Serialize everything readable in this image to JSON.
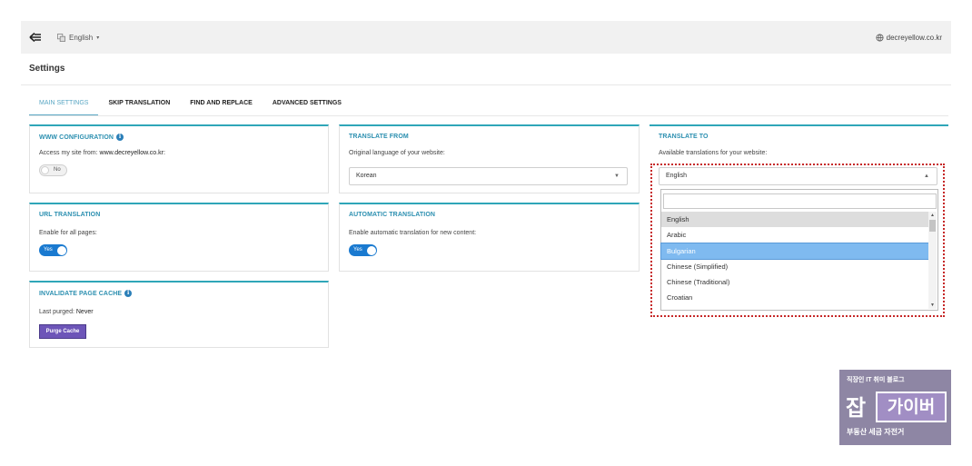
{
  "topbar": {
    "language": "English",
    "site": "decreyellow.co.kr"
  },
  "page_title": "Settings",
  "tabs": [
    {
      "label": "MAIN SETTINGS",
      "active": true
    },
    {
      "label": "SKIP TRANSLATION",
      "active": false
    },
    {
      "label": "FIND AND REPLACE",
      "active": false
    },
    {
      "label": "ADVANCED SETTINGS",
      "active": false
    }
  ],
  "panels": {
    "www": {
      "title": "WWW CONFIGURATION",
      "text_prefix": "Access my site from:",
      "text_value": "www.decreyellow.co.kr:",
      "toggle_label": "No",
      "toggle_on": false
    },
    "url": {
      "title": "URL TRANSLATION",
      "text": "Enable for all pages:",
      "toggle_label": "Yes",
      "toggle_on": true
    },
    "cache": {
      "title": "INVALIDATE PAGE CACHE",
      "text_prefix": "Last purged:",
      "text_value": "Never",
      "button_label": "Purge Cache"
    },
    "from": {
      "title": "TRANSLATE FROM",
      "text": "Original language of your website:",
      "selected": "Korean"
    },
    "auto": {
      "title": "AUTOMATIC TRANSLATION",
      "text": "Enable automatic translation for new content:",
      "toggle_label": "Yes",
      "toggle_on": true
    },
    "to": {
      "title": "TRANSLATE TO",
      "text": "Available translations for your website:",
      "selected": "English",
      "search_value": "",
      "options": [
        {
          "label": "English",
          "state": "selected"
        },
        {
          "label": "Arabic",
          "state": ""
        },
        {
          "label": "Bulgarian",
          "state": "highlighted"
        },
        {
          "label": "Chinese (Simplified)",
          "state": ""
        },
        {
          "label": "Chinese (Traditional)",
          "state": ""
        },
        {
          "label": "Croatian",
          "state": ""
        }
      ]
    }
  },
  "watermark": {
    "top": "직장인 IT 취미 블로그",
    "big": "잡",
    "box": "가이버",
    "bottom": "부동산 세금 자전거"
  },
  "colors": {
    "accent": "#2fa6b8",
    "title_blue": "#2b8fb0",
    "toggle_on": "#1a7ad0",
    "purge_button": "#6d55b8",
    "highlight_option": "#7fbaf0",
    "annotation_border": "#c62828"
  },
  "icons": {
    "back": "back-arrow-icon",
    "language": "globe-icon",
    "site": "globe-icon",
    "info": "info-icon",
    "dropdown": "chevron-down-icon",
    "dropdown_open": "chevron-up-icon"
  }
}
